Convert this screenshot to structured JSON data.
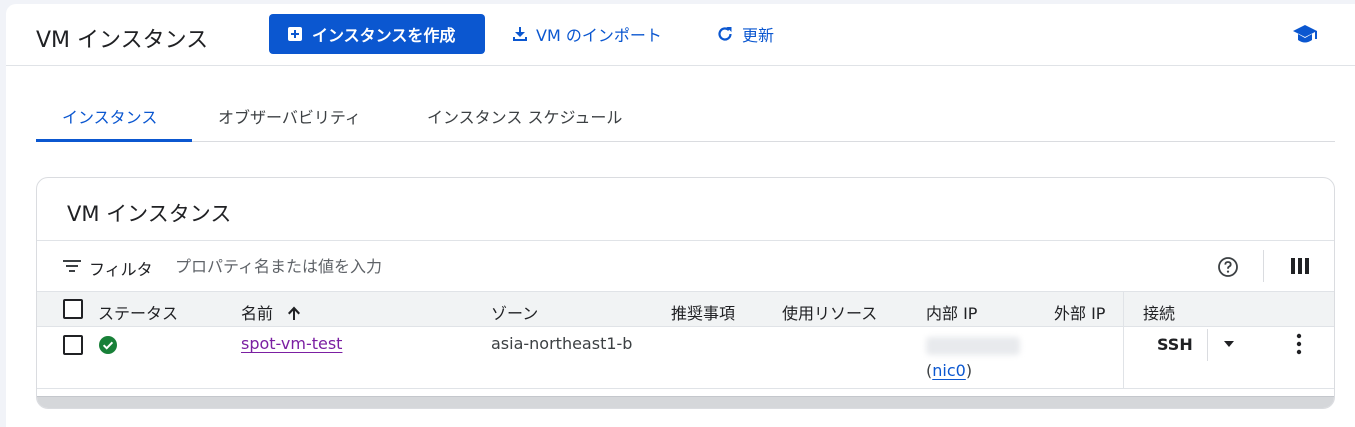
{
  "header": {
    "title": "VM インスタンス",
    "create_label": "インスタンスを作成",
    "import_label": "VM のインポート",
    "refresh_label": "更新"
  },
  "tabs": [
    {
      "label": "インスタンス",
      "active": true
    },
    {
      "label": "オブザーバビリティ",
      "active": false
    },
    {
      "label": "インスタンス スケジュール",
      "active": false
    }
  ],
  "card": {
    "title": "VM インスタンス",
    "filter": {
      "label": "フィルタ",
      "placeholder": "プロパティ名または値を入力"
    },
    "columns": [
      "ステータス",
      "名前",
      "ゾーン",
      "推奨事項",
      "使用リソース",
      "内部 IP",
      "外部 IP",
      "接続"
    ],
    "rows": [
      {
        "name": "spot-vm-test",
        "zone": "asia-northeast1-b",
        "internal_ip_nic": "nic0",
        "connect_label": "SSH"
      }
    ]
  },
  "colors": {
    "primary": "#0b57d0",
    "status_ok": "#188038",
    "link_visited": "#7b1fa2"
  }
}
